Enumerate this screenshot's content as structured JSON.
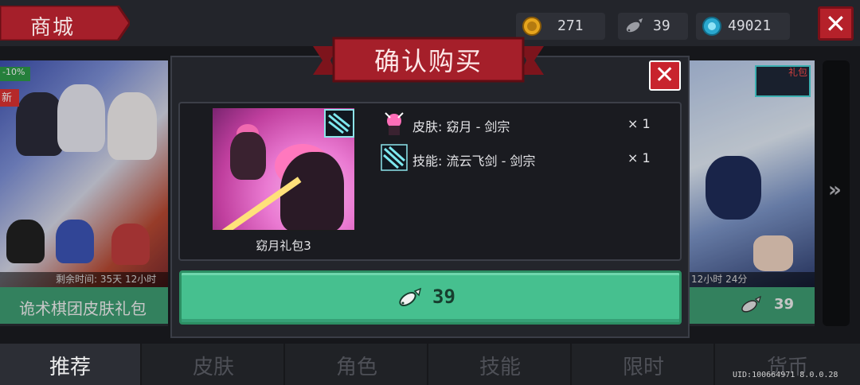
{
  "header": {
    "title": "商城",
    "currencies": [
      {
        "name": "gold",
        "value": "271"
      },
      {
        "name": "fish",
        "value": "39"
      },
      {
        "name": "gem",
        "value": "49021"
      }
    ]
  },
  "cards": {
    "left": {
      "discount": "-10%",
      "new_badge": "新",
      "time_left": "剩余时间: 35天 12小时",
      "name": "诡术棋团皮肤礼包"
    },
    "right": {
      "badge": "礼包",
      "time_left": "12小时 24分",
      "price": "39"
    }
  },
  "modal": {
    "title": "确认购买",
    "pack_name": "窈月礼包3",
    "items": [
      {
        "label": "皮肤: 窈月 - 剑宗",
        "qty": "× 1"
      },
      {
        "label": "技能: 流云飞剑 - 剑宗",
        "qty": "× 1"
      }
    ],
    "price": "39"
  },
  "tabs": [
    "推荐",
    "皮肤",
    "角色",
    "技能",
    "限时",
    "货币"
  ],
  "uid": "UID:100664971 8.0.0.28",
  "colors": {
    "accent_green": "#46c08f",
    "banner_red": "#a51f2a",
    "close_red": "#c8232d"
  }
}
